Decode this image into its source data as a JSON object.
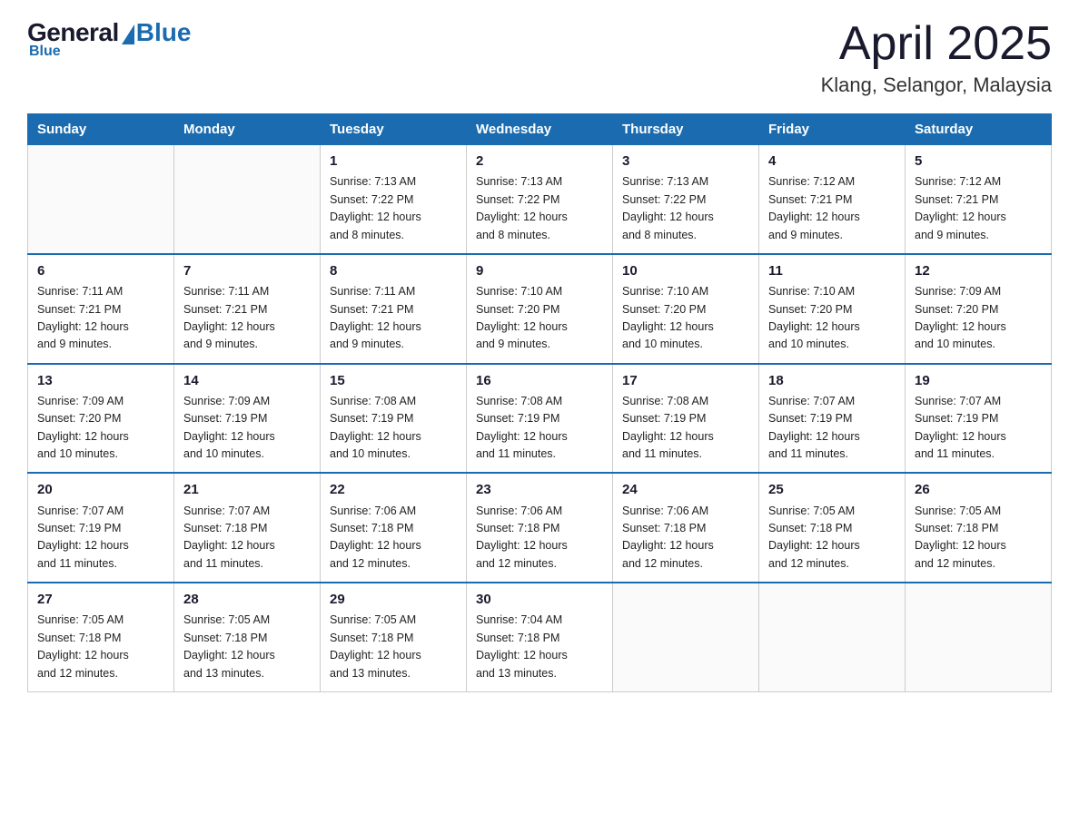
{
  "header": {
    "logo": {
      "general": "General",
      "blue": "Blue"
    },
    "title": "April 2025",
    "location": "Klang, Selangor, Malaysia"
  },
  "calendar": {
    "days_of_week": [
      "Sunday",
      "Monday",
      "Tuesday",
      "Wednesday",
      "Thursday",
      "Friday",
      "Saturday"
    ],
    "weeks": [
      [
        {
          "day": "",
          "info": ""
        },
        {
          "day": "",
          "info": ""
        },
        {
          "day": "1",
          "info": "Sunrise: 7:13 AM\nSunset: 7:22 PM\nDaylight: 12 hours\nand 8 minutes."
        },
        {
          "day": "2",
          "info": "Sunrise: 7:13 AM\nSunset: 7:22 PM\nDaylight: 12 hours\nand 8 minutes."
        },
        {
          "day": "3",
          "info": "Sunrise: 7:13 AM\nSunset: 7:22 PM\nDaylight: 12 hours\nand 8 minutes."
        },
        {
          "day": "4",
          "info": "Sunrise: 7:12 AM\nSunset: 7:21 PM\nDaylight: 12 hours\nand 9 minutes."
        },
        {
          "day": "5",
          "info": "Sunrise: 7:12 AM\nSunset: 7:21 PM\nDaylight: 12 hours\nand 9 minutes."
        }
      ],
      [
        {
          "day": "6",
          "info": "Sunrise: 7:11 AM\nSunset: 7:21 PM\nDaylight: 12 hours\nand 9 minutes."
        },
        {
          "day": "7",
          "info": "Sunrise: 7:11 AM\nSunset: 7:21 PM\nDaylight: 12 hours\nand 9 minutes."
        },
        {
          "day": "8",
          "info": "Sunrise: 7:11 AM\nSunset: 7:21 PM\nDaylight: 12 hours\nand 9 minutes."
        },
        {
          "day": "9",
          "info": "Sunrise: 7:10 AM\nSunset: 7:20 PM\nDaylight: 12 hours\nand 9 minutes."
        },
        {
          "day": "10",
          "info": "Sunrise: 7:10 AM\nSunset: 7:20 PM\nDaylight: 12 hours\nand 10 minutes."
        },
        {
          "day": "11",
          "info": "Sunrise: 7:10 AM\nSunset: 7:20 PM\nDaylight: 12 hours\nand 10 minutes."
        },
        {
          "day": "12",
          "info": "Sunrise: 7:09 AM\nSunset: 7:20 PM\nDaylight: 12 hours\nand 10 minutes."
        }
      ],
      [
        {
          "day": "13",
          "info": "Sunrise: 7:09 AM\nSunset: 7:20 PM\nDaylight: 12 hours\nand 10 minutes."
        },
        {
          "day": "14",
          "info": "Sunrise: 7:09 AM\nSunset: 7:19 PM\nDaylight: 12 hours\nand 10 minutes."
        },
        {
          "day": "15",
          "info": "Sunrise: 7:08 AM\nSunset: 7:19 PM\nDaylight: 12 hours\nand 10 minutes."
        },
        {
          "day": "16",
          "info": "Sunrise: 7:08 AM\nSunset: 7:19 PM\nDaylight: 12 hours\nand 11 minutes."
        },
        {
          "day": "17",
          "info": "Sunrise: 7:08 AM\nSunset: 7:19 PM\nDaylight: 12 hours\nand 11 minutes."
        },
        {
          "day": "18",
          "info": "Sunrise: 7:07 AM\nSunset: 7:19 PM\nDaylight: 12 hours\nand 11 minutes."
        },
        {
          "day": "19",
          "info": "Sunrise: 7:07 AM\nSunset: 7:19 PM\nDaylight: 12 hours\nand 11 minutes."
        }
      ],
      [
        {
          "day": "20",
          "info": "Sunrise: 7:07 AM\nSunset: 7:19 PM\nDaylight: 12 hours\nand 11 minutes."
        },
        {
          "day": "21",
          "info": "Sunrise: 7:07 AM\nSunset: 7:18 PM\nDaylight: 12 hours\nand 11 minutes."
        },
        {
          "day": "22",
          "info": "Sunrise: 7:06 AM\nSunset: 7:18 PM\nDaylight: 12 hours\nand 12 minutes."
        },
        {
          "day": "23",
          "info": "Sunrise: 7:06 AM\nSunset: 7:18 PM\nDaylight: 12 hours\nand 12 minutes."
        },
        {
          "day": "24",
          "info": "Sunrise: 7:06 AM\nSunset: 7:18 PM\nDaylight: 12 hours\nand 12 minutes."
        },
        {
          "day": "25",
          "info": "Sunrise: 7:05 AM\nSunset: 7:18 PM\nDaylight: 12 hours\nand 12 minutes."
        },
        {
          "day": "26",
          "info": "Sunrise: 7:05 AM\nSunset: 7:18 PM\nDaylight: 12 hours\nand 12 minutes."
        }
      ],
      [
        {
          "day": "27",
          "info": "Sunrise: 7:05 AM\nSunset: 7:18 PM\nDaylight: 12 hours\nand 12 minutes."
        },
        {
          "day": "28",
          "info": "Sunrise: 7:05 AM\nSunset: 7:18 PM\nDaylight: 12 hours\nand 13 minutes."
        },
        {
          "day": "29",
          "info": "Sunrise: 7:05 AM\nSunset: 7:18 PM\nDaylight: 12 hours\nand 13 minutes."
        },
        {
          "day": "30",
          "info": "Sunrise: 7:04 AM\nSunset: 7:18 PM\nDaylight: 12 hours\nand 13 minutes."
        },
        {
          "day": "",
          "info": ""
        },
        {
          "day": "",
          "info": ""
        },
        {
          "day": "",
          "info": ""
        }
      ]
    ]
  }
}
